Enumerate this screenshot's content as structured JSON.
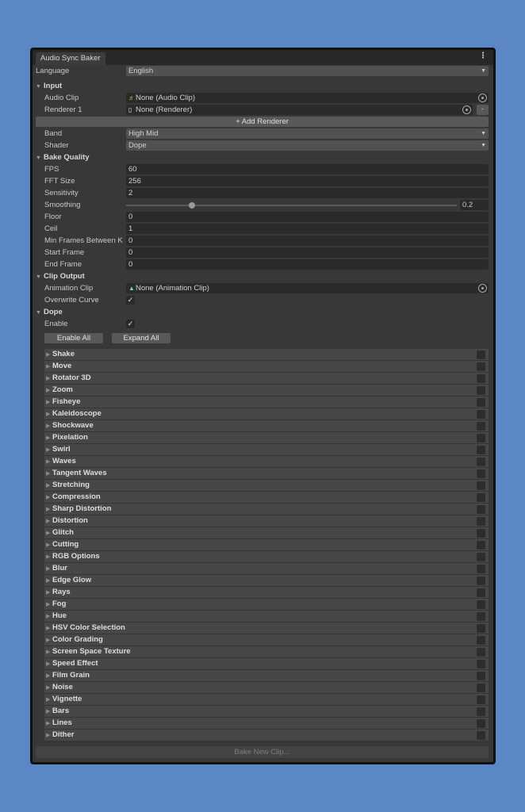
{
  "window": {
    "tab_title": "Audio Sync Baker",
    "menu_icon": "kebab-menu-icon"
  },
  "language": {
    "label": "Language",
    "value": "English"
  },
  "input": {
    "header": "Input",
    "audio_clip": {
      "label": "Audio Clip",
      "value": "None (Audio Clip)"
    },
    "renderer1": {
      "label": "Renderer 1",
      "value": "None (Renderer)",
      "remove": "-"
    },
    "add_renderer": "+ Add Renderer",
    "band": {
      "label": "Band",
      "value": "High Mid"
    },
    "shader": {
      "label": "Shader",
      "value": "Dope"
    }
  },
  "bake_quality": {
    "header": "Bake Quality",
    "fps": {
      "label": "FPS",
      "value": "60"
    },
    "fft": {
      "label": "FFT Size",
      "value": "256"
    },
    "sensitivity": {
      "label": "Sensitivity",
      "value": "2"
    },
    "smoothing": {
      "label": "Smoothing",
      "value": "0.2",
      "fraction": 0.2
    },
    "floor": {
      "label": "Floor",
      "value": "0"
    },
    "ceil": {
      "label": "Ceil",
      "value": "1"
    },
    "min_frames": {
      "label": "Min Frames Between K",
      "value": "0"
    },
    "start_frame": {
      "label": "Start Frame",
      "value": "0"
    },
    "end_frame": {
      "label": "End Frame",
      "value": "0"
    }
  },
  "clip_output": {
    "header": "Clip Output",
    "animation_clip": {
      "label": "Animation Clip",
      "value": "None (Animation Clip)"
    },
    "overwrite": {
      "label": "Overwrite Curve",
      "checked": true
    }
  },
  "dope": {
    "header": "Dope",
    "enable": {
      "label": "Enable",
      "checked": true
    },
    "enable_all": "Enable All",
    "expand_all": "Expand All",
    "effects": [
      "Shake",
      "Move",
      "Rotator 3D",
      "Zoom",
      "Fisheye",
      "Kaleidoscope",
      "Shockwave",
      "Pixelation",
      "Swirl",
      "Waves",
      "Tangent Waves",
      "Stretching",
      "Compression",
      "Sharp Distortion",
      "Distortion",
      "Glitch",
      "Cutting",
      "RGB Options",
      "Blur",
      "Edge Glow",
      "Rays",
      "Fog",
      "Hue",
      "HSV Color Selection",
      "Color Grading",
      "Screen Space Texture",
      "Speed Effect",
      "Film Grain",
      "Noise",
      "Vignette",
      "Bars",
      "Lines",
      "Dither"
    ]
  },
  "bake_button": "Bake New Clip..."
}
